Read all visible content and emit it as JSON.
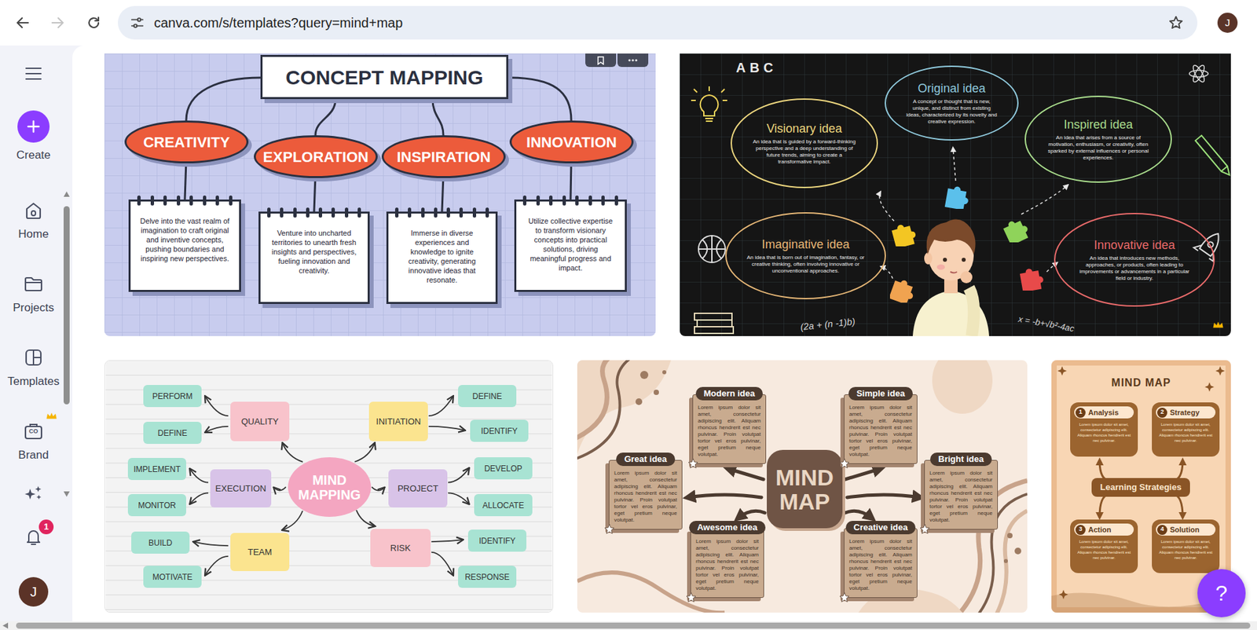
{
  "browser": {
    "url": "canva.com/s/templates?query=mind+map",
    "back_enabled": true,
    "forward_enabled": false,
    "bookmarked": false,
    "profile": "J"
  },
  "sidebar": {
    "create": "Create",
    "items": [
      {
        "label": "Home",
        "selected": false,
        "premium": false
      },
      {
        "label": "Projects",
        "selected": false,
        "premium": false
      },
      {
        "label": "Templates",
        "selected": false,
        "premium": false
      },
      {
        "label": "Brand",
        "selected": false,
        "premium": true,
        "mark": "CO"
      }
    ],
    "notifications": "1",
    "avatar": "J"
  },
  "templates": [
    {
      "kind": "concept",
      "premium": false,
      "hovered": true,
      "title": "CONCEPT MAPPING",
      "branches": [
        {
          "label": "CREATIVITY",
          "text": "Delve into the vast realm of imagination to craft original and inventive concepts, pushing boundaries and inspiring new perspectives."
        },
        {
          "label": "EXPLORATION",
          "text": "Venture into uncharted territories to unearth fresh insights and perspectives, fueling innovation and creativity."
        },
        {
          "label": "INSPIRATION",
          "text": "Immerse in diverse experiences and knowledge to ignite creativity, generating innovative ideas that resonate."
        },
        {
          "label": "INNOVATION",
          "text": "Utilize collective expertise to transform visionary concepts into practical solutions, driving meaningful progress and impact."
        }
      ]
    },
    {
      "kind": "ideas",
      "premium": true,
      "hovered": false,
      "letters": "ABC",
      "formulas": [
        "(2a + (n -1)b)",
        "x = -b+√b²-4ac"
      ],
      "clouds": [
        {
          "title": "Original idea",
          "text": "A concept or thought that is new, unique, and distinct from existing ideas, characterized by its novelty and creative expression.",
          "color": "#8fc9dc"
        },
        {
          "title": "Visionary idea",
          "text": "An idea that is guided by a forward-thinking perspective and a deep understanding of future trends, aiming to create a transformative impact.",
          "color": "#ecd57e"
        },
        {
          "title": "Inspired idea",
          "text": "An idea that arises from a source of motivation, enthusiasm, or creativity, often sparked by external influences or personal experiences.",
          "color": "#a9dc8c"
        },
        {
          "title": "Imaginative idea",
          "text": "An idea that is born out of imagination, fantasy, or creative thinking, often involving innovative or unconventional approaches.",
          "color": "#e5b676"
        },
        {
          "title": "Innovative idea",
          "text": "An idea that introduces new methods, approaches, or products, often leading to improvements or advancements in a particular field or industry.",
          "color": "#e86a6a"
        }
      ]
    },
    {
      "kind": "pastel",
      "premium": false,
      "hovered": false,
      "center": "MIND MAPPING",
      "branches": [
        {
          "label": "QUALITY",
          "color": "#f8c3cb",
          "leaves": [
            "PERFORM",
            "DEFINE"
          ]
        },
        {
          "label": "INITIATION",
          "color": "#fbe48f",
          "leaves": [
            "DEFINE",
            "IDENTIFY"
          ]
        },
        {
          "label": "EXECUTION",
          "color": "#d8c3e8",
          "leaves": [
            "IMPLEMENT",
            "MONITOR"
          ]
        },
        {
          "label": "PROJECT",
          "color": "#d8c3e8",
          "leaves": [
            "DEVELOP",
            "ALLOCATE"
          ]
        },
        {
          "label": "TEAM",
          "color": "#fbe48f",
          "leaves": [
            "BUILD",
            "MOTIVATE"
          ]
        },
        {
          "label": "RISK",
          "color": "#f8c3cb",
          "leaves": [
            "IDENTIFY",
            "RESPONSE"
          ]
        }
      ]
    },
    {
      "kind": "brown",
      "premium": false,
      "hovered": false,
      "center": "MIND MAP",
      "ideas": [
        {
          "title": "Modern idea",
          "text": "Lorem ipsum dolor sit amet, consectetur adipiscing elit. Aliquam rhoncus hendrerit est nec pulvinar. Proin volutpat tortor vel eros pulvinar, eget pretium neque volutpat."
        },
        {
          "title": "Simple idea",
          "text": "Lorem ipsum dolor sit amet, consectetur adipiscing elit. Aliquam rhoncus hendrerit est nec pulvinar. Proin volutpat tortor vel eros pulvinar, eget pretium neque volutpat."
        },
        {
          "title": "Great idea",
          "text": "Lorem ipsum dolor sit amet, consectetur adipiscing elit. Aliquam rhoncus hendrerit est nec pulvinar. Proin volutpat tortor vel eros pulvinar, eget pretium neque volutpat."
        },
        {
          "title": "Bright idea",
          "text": "Lorem ipsum dolor sit amet, consectetur adipiscing elit. Aliquam rhoncus hendrerit est nec pulvinar. Proin volutpat tortor vel eros pulvinar, eget pretium neque volutpat."
        },
        {
          "title": "Awesome idea",
          "text": "Lorem ipsum dolor sit amet, consectetur adipiscing elit. Aliquam rhoncus hendrerit est nec pulvinar. Proin volutpat tortor vel eros pulvinar, eget pretium neque volutpat."
        },
        {
          "title": "Creative idea",
          "text": "Lorem ipsum dolor sit amet, consectetur adipiscing elit. Aliquam rhoncus hendrerit est nec pulvinar. Proin volutpat tortor vel eros pulvinar, eget pretium neque volutpat."
        }
      ]
    },
    {
      "kind": "learning",
      "premium": false,
      "hovered": false,
      "title": "MIND MAP",
      "center": "Learning Strategies",
      "items": [
        {
          "number": "1",
          "label": "Analysis",
          "text": "Lorem ipsum dolor sit amet, consectetur adipiscing elit. Aliquam rhoncus hendrerit est nec pulvinar."
        },
        {
          "number": "2",
          "label": "Strategy",
          "text": "Lorem ipsum dolor sit amet, consectetur adipiscing elit. Aliquam rhoncus hendrerit est nec pulvinar."
        },
        {
          "number": "3",
          "label": "Action",
          "text": "Lorem ipsum dolor sit amet, consectetur adipiscing elit. Aliquam rhoncus hendrerit est nec pulvinar."
        },
        {
          "number": "4",
          "label": "Solution",
          "text": "Lorem ipsum dolor sit amet, consectetur adipiscing elit. Aliquam rhoncus hendrerit est nec pulvinar."
        }
      ]
    }
  ],
  "help": "?"
}
